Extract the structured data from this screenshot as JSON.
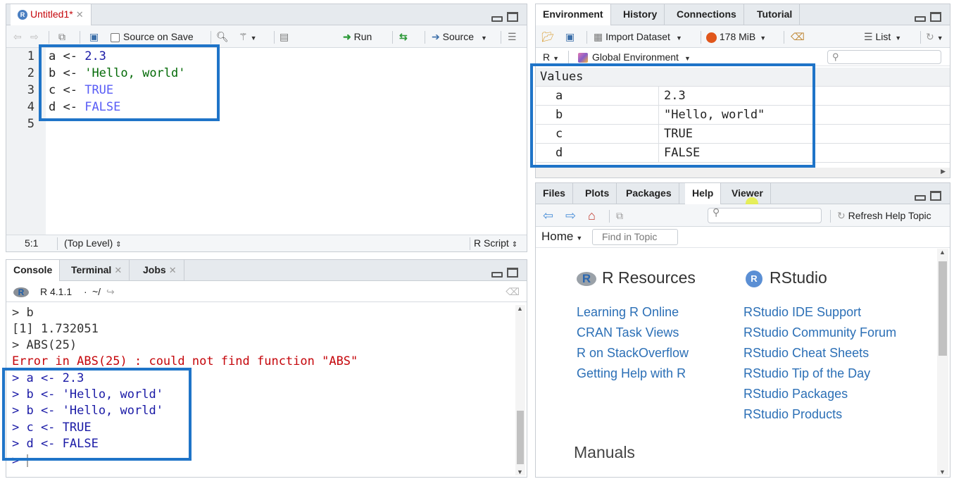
{
  "editor": {
    "tab_title": "Untitled1*",
    "source_on_save": "Source on Save",
    "run": "Run",
    "source": "Source",
    "lines": [
      {
        "num": "1",
        "var": "a",
        "op": " <- ",
        "val": "2.3",
        "color": "#1a1aa6"
      },
      {
        "num": "2",
        "var": "b",
        "op": " <- ",
        "val": "'Hello, world'",
        "color": "#036a07"
      },
      {
        "num": "3",
        "var": "c",
        "op": " <- ",
        "val": "TRUE",
        "color": "#585cf6"
      },
      {
        "num": "4",
        "var": "d",
        "op": " <- ",
        "val": "FALSE",
        "color": "#585cf6"
      },
      {
        "num": "5",
        "var": "",
        "op": "",
        "val": "",
        "color": "#000"
      }
    ],
    "status_pos": "5:1",
    "status_scope": "(Top Level)",
    "status_type": "R Script"
  },
  "console": {
    "tabs": [
      "Console",
      "Terminal",
      "Jobs"
    ],
    "version": "R 4.1.1",
    "path": "~/",
    "lines": [
      {
        "text": "> b",
        "color": "#333333"
      },
      {
        "text": "[1] 1.732051",
        "color": "#333333"
      },
      {
        "text": "> ABS(25)",
        "color": "#333333"
      },
      {
        "text": "Error in ABS(25) : could not find function \"ABS\"",
        "color": "#c5060b"
      },
      {
        "text": "> a <- 2.3",
        "color": "#1a1aa6"
      },
      {
        "text": "> b <- 'Hello, world'",
        "color": "#1a1aa6"
      },
      {
        "text": "> b <- 'Hello, world'",
        "color": "#1a1aa6"
      },
      {
        "text": "> c <- TRUE",
        "color": "#1a1aa6"
      },
      {
        "text": "> d <- FALSE",
        "color": "#1a1aa6"
      }
    ],
    "prompt": ">"
  },
  "environment": {
    "tabs": [
      "Environment",
      "History",
      "Connections",
      "Tutorial"
    ],
    "import_dataset": "Import Dataset",
    "memory": "178 MiB",
    "list_label": "List",
    "lang": "R",
    "scope": "Global Environment",
    "section": "Values",
    "rows": [
      {
        "name": "a",
        "value": "2.3"
      },
      {
        "name": "b",
        "value": "\"Hello, world\""
      },
      {
        "name": "c",
        "value": "TRUE"
      },
      {
        "name": "d",
        "value": "FALSE"
      }
    ]
  },
  "help": {
    "tabs": [
      "Files",
      "Plots",
      "Packages",
      "Help",
      "Viewer"
    ],
    "refresh": "Refresh Help Topic",
    "home": "Home",
    "find_placeholder": "Find in Topic",
    "r_resources_title": "R Resources",
    "rstudio_title": "RStudio",
    "r_links": [
      "Learning R Online",
      "CRAN Task Views",
      "R on StackOverflow",
      "Getting Help with R"
    ],
    "rstudio_links": [
      "RStudio IDE Support",
      "RStudio Community Forum",
      "RStudio Cheat Sheets",
      "RStudio Tip of the Day",
      "RStudio Packages",
      "RStudio Products"
    ],
    "manuals": "Manuals"
  },
  "colors": {
    "highlight": "#1f74c8",
    "link": "#2b6fb6",
    "error": "#c5060b"
  }
}
